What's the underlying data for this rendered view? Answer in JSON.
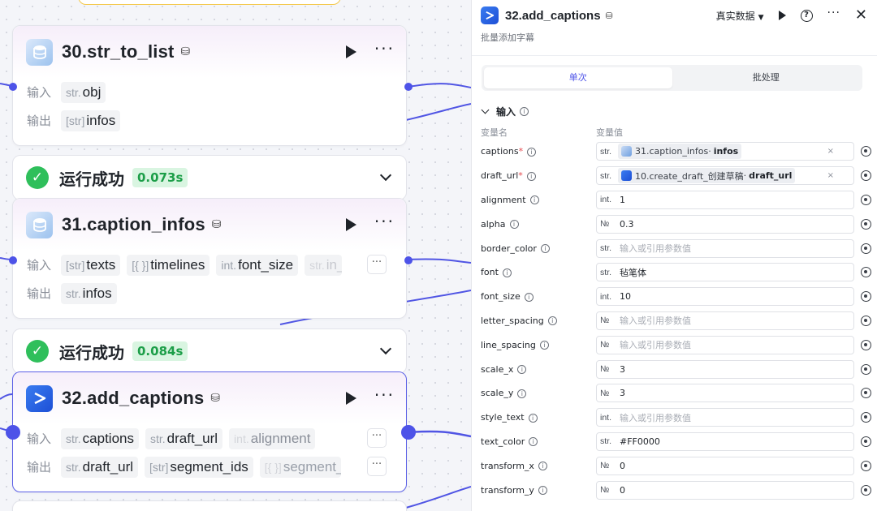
{
  "canvas": {
    "nodes": [
      {
        "key": "n30",
        "title": "30.str_to_list",
        "icon": "database-icon",
        "inputs": [
          {
            "type": "str.",
            "name": "obj"
          }
        ],
        "outputs": [
          {
            "type": "[str]",
            "name": "infos"
          }
        ],
        "input_label": "输入",
        "output_label": "输出"
      },
      {
        "key": "n31",
        "title": "31.caption_infos",
        "icon": "database-icon",
        "inputs": [
          {
            "type": "[str]",
            "name": "texts"
          },
          {
            "type": "[{ }]",
            "name": "timelines"
          },
          {
            "type": "int.",
            "name": "font_size"
          },
          {
            "type": "str.",
            "name": "in_"
          }
        ],
        "outputs": [
          {
            "type": "str.",
            "name": "infos"
          }
        ],
        "input_label": "输入",
        "output_label": "输出"
      },
      {
        "key": "n32",
        "title": "32.add_captions",
        "icon": "capcut-icon",
        "inputs": [
          {
            "type": "str.",
            "name": "captions"
          },
          {
            "type": "str.",
            "name": "draft_url"
          },
          {
            "type": "int.",
            "name": "alignment"
          }
        ],
        "outputs": [
          {
            "type": "str.",
            "name": "draft_url"
          },
          {
            "type": "[str]",
            "name": "segment_ids"
          },
          {
            "type": "[{ }]",
            "name": "segment_"
          }
        ],
        "input_label": "输入",
        "output_label": "输出"
      }
    ],
    "status": [
      {
        "text": "运行成功",
        "time": "0.073s"
      },
      {
        "text": "运行成功",
        "time": "0.084s"
      }
    ]
  },
  "panel": {
    "title": "32.add_captions",
    "description": "批量添加字幕",
    "env_select": "真实数据",
    "tabs": [
      {
        "label": "单次",
        "active": true
      },
      {
        "label": "批处理",
        "active": false
      }
    ],
    "section_title": "输入",
    "col_name": "变量名",
    "col_value": "变量值",
    "params": [
      {
        "name": "captions",
        "required": true,
        "type": "str.",
        "ref": {
          "icon": "database-icon",
          "node": "31.caption_infos",
          "field": "infos"
        }
      },
      {
        "name": "draft_url",
        "required": true,
        "type": "str.",
        "ref": {
          "icon": "capcut-icon",
          "node": "10.create_draft_创建草稿",
          "field": "draft_url"
        }
      },
      {
        "name": "alignment",
        "type": "int.",
        "value": "1"
      },
      {
        "name": "alpha",
        "type": "№",
        "value": "0.3"
      },
      {
        "name": "border_color",
        "type": "str.",
        "placeholder": "输入或引用参数值"
      },
      {
        "name": "font",
        "type": "str.",
        "value": "毡笔体"
      },
      {
        "name": "font_size",
        "type": "int.",
        "value": "10"
      },
      {
        "name": "letter_spacing",
        "type": "№",
        "placeholder": "输入或引用参数值"
      },
      {
        "name": "line_spacing",
        "type": "№",
        "placeholder": "输入或引用参数值"
      },
      {
        "name": "scale_x",
        "type": "№",
        "value": "3"
      },
      {
        "name": "scale_y",
        "type": "№",
        "value": "3"
      },
      {
        "name": "style_text",
        "type": "int.",
        "placeholder": "输入或引用参数值"
      },
      {
        "name": "text_color",
        "type": "str.",
        "value": "#FF0000"
      },
      {
        "name": "transform_x",
        "type": "№",
        "value": "0"
      },
      {
        "name": "transform_y",
        "type": "№",
        "value": "0"
      }
    ]
  },
  "colors": {
    "accent": "#4d53e8",
    "success": "#2fbf5b",
    "success_bg": "#d9f5e1",
    "required": "#e5484d"
  }
}
